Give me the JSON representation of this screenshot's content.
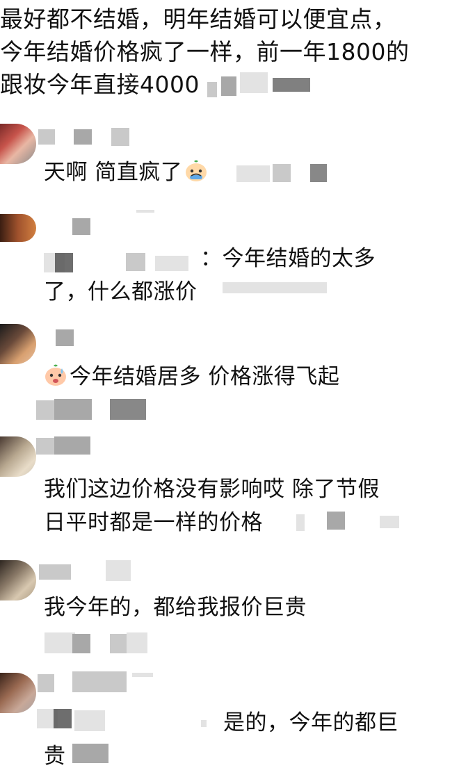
{
  "post": {
    "lines": [
      "最好都不结婚，明年结婚可以便宜点，",
      "今年结婚价格疯了一样，前一年1800的",
      "跟妆今年直接4000"
    ]
  },
  "comments": [
    {
      "lines": [
        "天啊 简直疯了"
      ],
      "emoji": "crying-face-emoji"
    },
    {
      "reply_text_line1": "：今年结婚的太多",
      "reply_text_line2": "了，什么都涨价"
    },
    {
      "lines": [
        "今年结婚居多  价格涨得飞起"
      ],
      "emoji": "sweating-face-emoji"
    },
    {
      "lines": [
        "我们这边价格没有影响哎  除了节假",
        "日平时都是一样的价格"
      ]
    },
    {
      "lines": [
        "我今年的，都给我报价巨贵"
      ]
    },
    {
      "reply_text_line1": "是的，今年的都巨",
      "reply_text_line2": "贵"
    }
  ],
  "colors": {
    "text": "#111111",
    "background": "#ffffff",
    "blur": "#9a9a9a"
  }
}
